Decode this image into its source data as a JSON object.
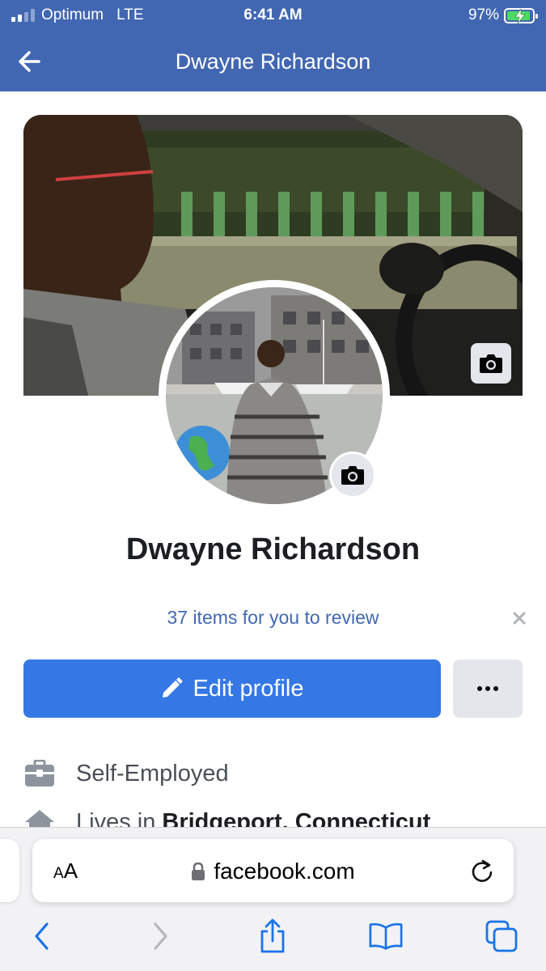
{
  "status_bar": {
    "carrier": "Optimum",
    "network": "LTE",
    "time": "6:41 AM",
    "battery_percent": "97%",
    "battery_level": 0.97,
    "signal_bars_filled": 2,
    "signal_bars_total": 4
  },
  "header": {
    "title": "Dwayne Richardson",
    "back_icon": "arrow-left-icon",
    "background_color": "#4267b2"
  },
  "profile": {
    "name": "Dwayne Richardson",
    "cover_camera_icon": "camera-icon",
    "avatar_camera_icon": "camera-icon"
  },
  "review_banner": {
    "text": "37 items for you to review",
    "close_icon": "close-icon"
  },
  "actions": {
    "edit_profile_label": "Edit profile",
    "edit_icon": "pencil-icon",
    "more_icon": "more-horizontal-icon",
    "primary_color": "#3578e5"
  },
  "info": {
    "work": {
      "text": "Self-Employed",
      "icon": "briefcase-icon"
    },
    "lives_in": {
      "prefix": "Lives in ",
      "place": "Bridgeport, Connecticut",
      "icon": "house-icon"
    }
  },
  "browser": {
    "text_size_label_small": "A",
    "text_size_label_large": "A",
    "url": "facebook.com",
    "lock_icon": "lock-icon",
    "reload_icon": "reload-icon",
    "toolbar_icons": [
      "back-icon",
      "forward-icon",
      "share-icon",
      "bookmarks-icon",
      "tabs-icon"
    ],
    "tint_color": "#1a73e8"
  }
}
